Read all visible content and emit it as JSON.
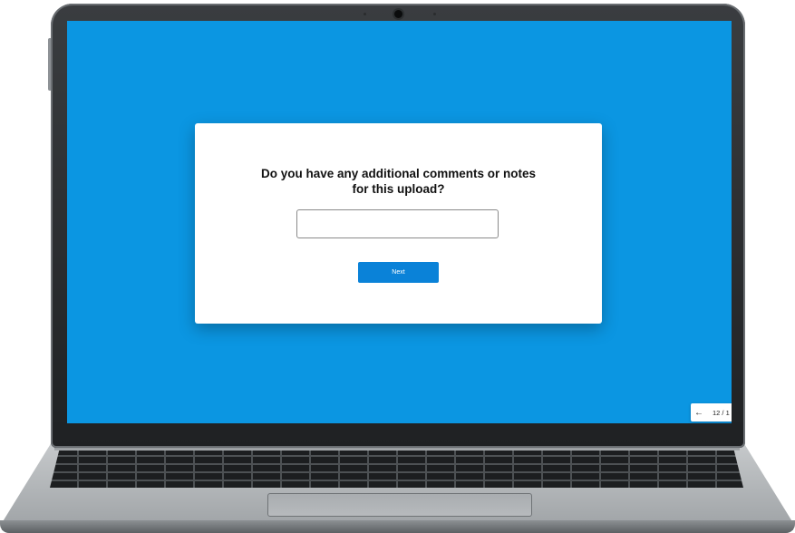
{
  "dialog": {
    "question_line1": "Do you have any additional comments or notes",
    "question_line2": "for this upload?",
    "comment_input": {
      "value": "",
      "placeholder": ""
    },
    "next_label": "Next"
  },
  "pager": {
    "back_icon": "←",
    "count": "12 / 1"
  },
  "colors": {
    "screen_background": "#0b96e2",
    "dialog_background": "#ffffff",
    "next_button": "#0a82d8"
  },
  "icons": [
    "arrow-left-icon",
    "camera-icon"
  ]
}
